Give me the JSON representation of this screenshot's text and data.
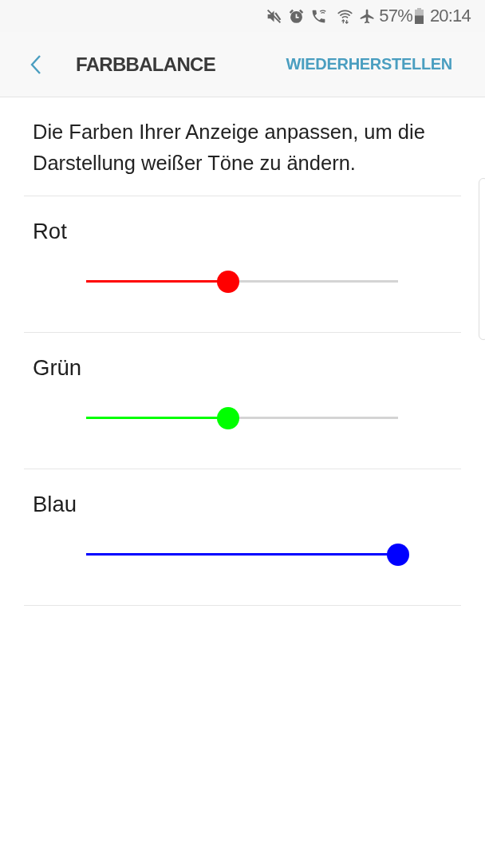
{
  "status_bar": {
    "battery_percent": "57%",
    "time": "20:14"
  },
  "header": {
    "title": "FARBBALANCE",
    "action": "WIEDERHERSTELLEN"
  },
  "description": "Die Farben Ihrer Anzeige anpassen, um die Darstellung weißer Töne zu ändern.",
  "channels": [
    {
      "name": "Rot",
      "color": "#ff0000",
      "level": 0.455
    },
    {
      "name": "Grün",
      "color": "#00ff00",
      "level": 0.455
    },
    {
      "name": "Blau",
      "color": "#0000ff",
      "level": 1
    }
  ]
}
